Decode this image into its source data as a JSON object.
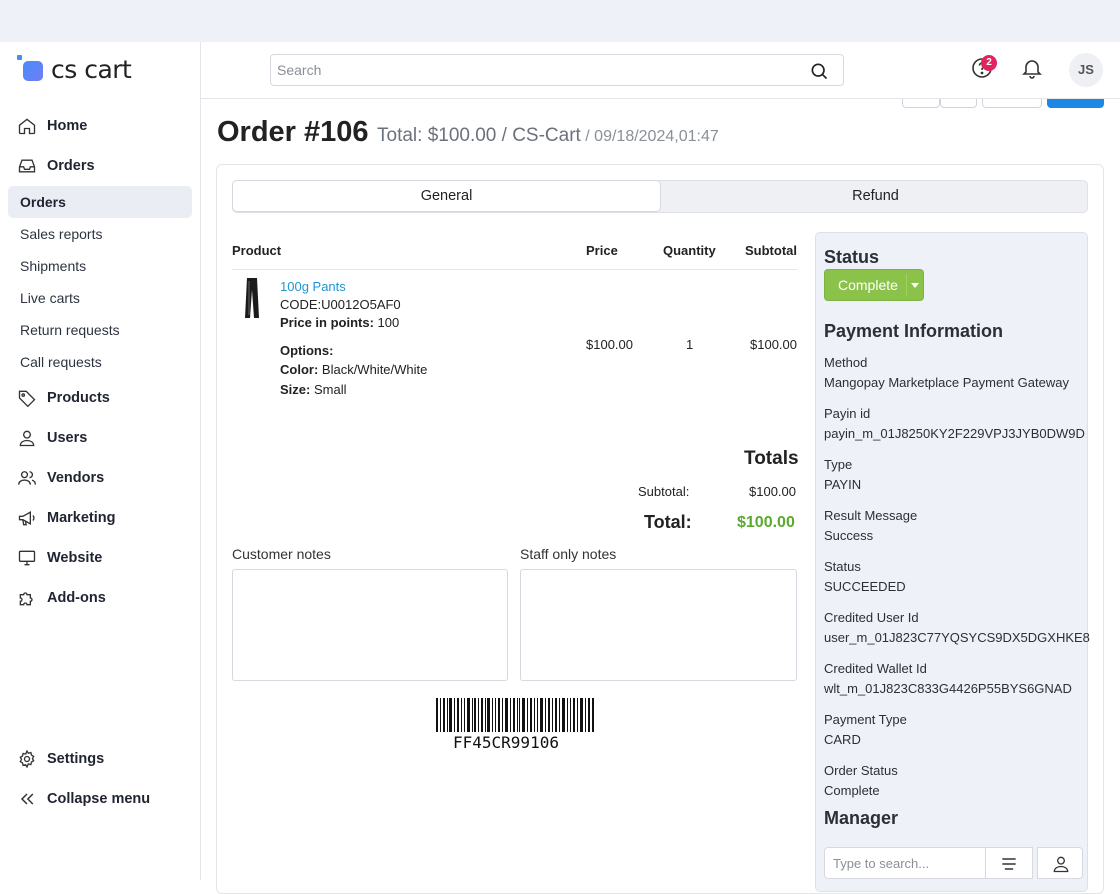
{
  "brand": {
    "logo_text": "cs cart"
  },
  "sidebar": {
    "items": [
      {
        "label": "Home",
        "icon": "home-icon"
      },
      {
        "label": "Orders",
        "icon": "inbox-icon"
      }
    ],
    "order_subitems": [
      "Orders",
      "Sales reports",
      "Shipments",
      "Live carts",
      "Return requests",
      "Call requests"
    ],
    "more_items": [
      {
        "label": "Products",
        "icon": "tag-icon"
      },
      {
        "label": "Users",
        "icon": "user-icon"
      },
      {
        "label": "Vendors",
        "icon": "users-icon"
      },
      {
        "label": "Marketing",
        "icon": "megaphone-icon"
      },
      {
        "label": "Website",
        "icon": "monitor-icon"
      },
      {
        "label": "Add-ons",
        "icon": "puzzle-icon"
      }
    ],
    "settings_label": "Settings",
    "collapse_label": "Collapse menu"
  },
  "header": {
    "search_placeholder": "Search",
    "help_badge": "2",
    "avatar_initials": "JS"
  },
  "order": {
    "title": "Order #106",
    "total_text": "Total: $100.00 / CS-Cart",
    "date_text": "/ 09/18/2024,01:47"
  },
  "tabs": {
    "general": "General",
    "refund": "Refund"
  },
  "table": {
    "headers": {
      "product": "Product",
      "price": "Price",
      "quantity": "Quantity",
      "subtotal": "Subtotal"
    },
    "row": {
      "name": "100g Pants",
      "code": "CODE:U0012O5AF0",
      "points_label": "Price in points:",
      "points_value": "100",
      "options_label": "Options:",
      "color_label": "Color:",
      "color_value": "Black/White/White",
      "size_label": "Size:",
      "size_value": "Small",
      "price": "$100.00",
      "quantity": "1",
      "subtotal": "$100.00"
    }
  },
  "totals": {
    "heading": "Totals",
    "subtotal_label": "Subtotal:",
    "subtotal_value": "$100.00",
    "total_label": "Total:",
    "total_value": "$100.00"
  },
  "notes": {
    "customer_label": "Customer notes",
    "staff_label": "Staff only notes"
  },
  "barcode_text": "FF45CR99106",
  "status": {
    "heading": "Status",
    "value": "Complete",
    "color": "#8bc34a"
  },
  "payment": {
    "heading": "Payment Information",
    "fields": [
      {
        "label": "Method",
        "value": "Mangopay Marketplace Payment Gateway"
      },
      {
        "label": "Payin id",
        "value": "payin_m_01J8250KY2F229VPJ3JYB0DW9D"
      },
      {
        "label": "Type",
        "value": "PAYIN"
      },
      {
        "label": "Result Message",
        "value": "Success"
      },
      {
        "label": "Status",
        "value": "SUCCEEDED"
      },
      {
        "label": "Credited User Id",
        "value": "user_m_01J823C77YQSYCS9DX5DGXHKE8"
      },
      {
        "label": "Credited Wallet Id",
        "value": "wlt_m_01J823C833G4426P55BYS6GNAD"
      },
      {
        "label": "Payment Type",
        "value": "CARD"
      },
      {
        "label": "Order Status",
        "value": "Complete"
      }
    ]
  },
  "manager": {
    "heading": "Manager",
    "search_placeholder": "Type to search..."
  },
  "colors": {
    "accent": "#1e88e5",
    "link": "#2196d3",
    "total_green": "#5aaa2c",
    "badge": "#e0245e"
  }
}
